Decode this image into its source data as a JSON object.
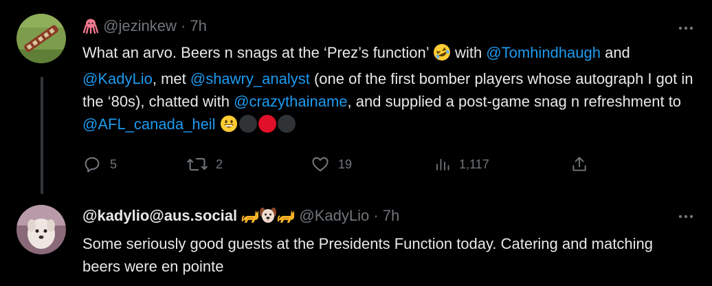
{
  "tweet1": {
    "handle": "@jezinkew",
    "time": "· 7h",
    "text_parts": [
      {
        "text": "What an arvo. Beers n snags at the ‘Prez’s function’ "
      },
      {
        "text": " with "
      },
      {
        "text": "@Tomhindhaugh",
        "mention": true
      },
      {
        "text": " and "
      },
      {
        "text": "@KadyLio",
        "mention": true
      },
      {
        "text": ", met "
      },
      {
        "text": "@shawry_analyst",
        "mention": true
      },
      {
        "text": " (one of the first bomber players whose autograph I got in the ‘80s), chatted with "
      },
      {
        "text": "@crazythainame",
        "mention": true
      },
      {
        "text": ", and supplied a post-game snag n refreshment to "
      },
      {
        "text": "@AFL_canada_heil",
        "mention": true
      },
      {
        "text": " "
      }
    ],
    "actions": {
      "replies": "5",
      "retweets": "2",
      "likes": "19",
      "views": "1,117"
    },
    "dot_colors": [
      "#2f3336",
      "#e0102a",
      "#2f3336"
    ]
  },
  "tweet2": {
    "display_name": "@kadylio@aus.social",
    "handle": "@KadyLio",
    "time": "· 7h",
    "text": "Some seriously good guests at the Presidents Function today. Catering and matching beers were en pointe"
  },
  "colors": {
    "background": "#000000",
    "text": "#e7e9ea",
    "muted": "#71767b",
    "link": "#1d9bf0"
  },
  "icons": [
    "octopus-icon",
    "rolling-laugh-emoji",
    "grinning-emoji",
    "cat-emoji",
    "dog-face-emoji",
    "more-icon",
    "reply-icon",
    "retweet-icon",
    "like-icon",
    "views-icon",
    "share-icon"
  ]
}
